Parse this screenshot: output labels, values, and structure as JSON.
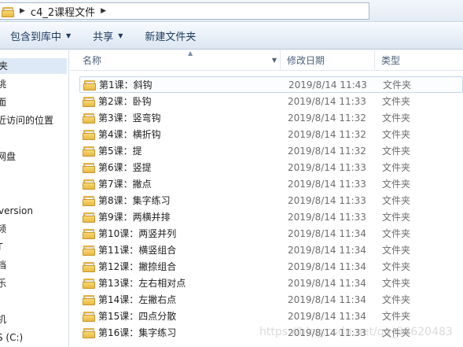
{
  "address": {
    "path_segments": [
      "c4_2课程文件"
    ]
  },
  "toolbar": {
    "include_in_library": "包含到库中",
    "share": "共享",
    "new_folder": "新建文件夹"
  },
  "nav": {
    "items": [
      "夹",
      "桃",
      "面",
      "近访问的位置",
      "网盘",
      "version",
      "频",
      "T",
      "档",
      "乐",
      "机",
      "S (C:)"
    ]
  },
  "columns": {
    "name": "名称",
    "date": "修改日期",
    "type": "类型"
  },
  "files": [
    {
      "name": "第1课：斜钩",
      "date": "2019/8/14 11:43",
      "type": "文件夹"
    },
    {
      "name": "第2课：卧钩",
      "date": "2019/8/14 11:33",
      "type": "文件夹"
    },
    {
      "name": "第3课：竖弯钩",
      "date": "2019/8/14 11:32",
      "type": "文件夹"
    },
    {
      "name": "第4课：横折钩",
      "date": "2019/8/14 11:32",
      "type": "文件夹"
    },
    {
      "name": "第5课：提",
      "date": "2019/8/14 11:32",
      "type": "文件夹"
    },
    {
      "name": "第6课：竖提",
      "date": "2019/8/14 11:33",
      "type": "文件夹"
    },
    {
      "name": "第7课：撇点",
      "date": "2019/8/14 11:33",
      "type": "文件夹"
    },
    {
      "name": "第8课：集字练习",
      "date": "2019/8/14 11:33",
      "type": "文件夹"
    },
    {
      "name": "第9课：两横并排",
      "date": "2019/8/14 11:33",
      "type": "文件夹"
    },
    {
      "name": "第10课：两竖并列",
      "date": "2019/8/14 11:34",
      "type": "文件夹"
    },
    {
      "name": "第11课：横竖组合",
      "date": "2019/8/14 11:34",
      "type": "文件夹"
    },
    {
      "name": "第12课：撇捺组合",
      "date": "2019/8/14 11:34",
      "type": "文件夹"
    },
    {
      "name": "第13课：左右相对点",
      "date": "2019/8/14 11:34",
      "type": "文件夹"
    },
    {
      "name": "第14课：左撇右点",
      "date": "2019/8/14 11:34",
      "type": "文件夹"
    },
    {
      "name": "第15课：四点分散",
      "date": "2019/8/14 11:34",
      "type": "文件夹"
    },
    {
      "name": "第16课：集字练习",
      "date": "2019/8/14 11:33",
      "type": "文件夹"
    }
  ],
  "watermark": "https://blog.csdn.net/qq_38620483"
}
